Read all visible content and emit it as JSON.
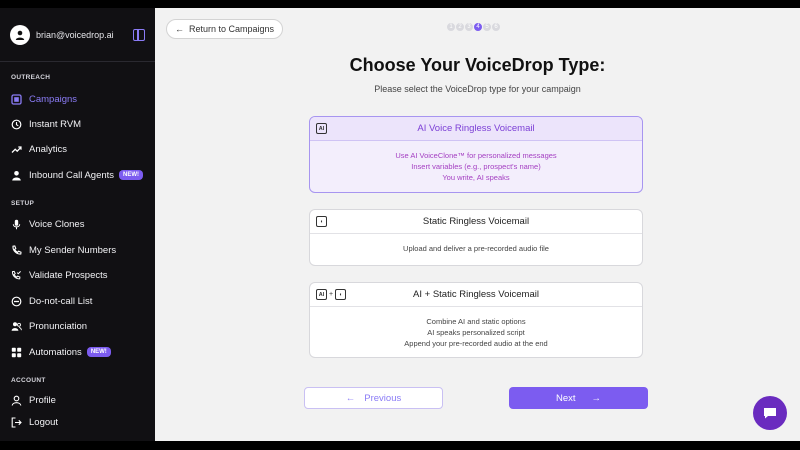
{
  "user": {
    "email": "brian@voicedrop.ai"
  },
  "sidebar": {
    "sections": {
      "outreach": "OUTREACH",
      "setup": "SETUP",
      "account": "ACCOUNT"
    },
    "items": [
      {
        "label": "Campaigns",
        "icon": "campaigns-icon",
        "active": true
      },
      {
        "label": "Instant RVM",
        "icon": "clock-icon"
      },
      {
        "label": "Analytics",
        "icon": "trend-icon"
      },
      {
        "label": "Inbound Call Agents",
        "icon": "person-icon",
        "badge": "NEW!"
      },
      {
        "label": "Voice Clones",
        "icon": "mic-icon"
      },
      {
        "label": "My Sender Numbers",
        "icon": "phone-icon"
      },
      {
        "label": "Validate Prospects",
        "icon": "phone-check-icon"
      },
      {
        "label": "Do-not-call List",
        "icon": "block-icon"
      },
      {
        "label": "Pronunciation",
        "icon": "users-icon"
      },
      {
        "label": "Automations",
        "icon": "grid-icon",
        "badge": "NEW!"
      },
      {
        "label": "Profile",
        "icon": "profile-icon"
      },
      {
        "label": "Logout",
        "icon": "logout-icon"
      }
    ]
  },
  "main": {
    "back_label": "Return to Campaigns",
    "steps": [
      "1",
      "2",
      "3",
      "4",
      "5",
      "6"
    ],
    "current_step": "4",
    "title": "Choose Your VoiceDrop Type:",
    "subtitle": "Please select the VoiceDrop type for your campaign",
    "options": [
      {
        "title": "AI Voice Ringless Voicemail",
        "lines": [
          "Use AI VoiceClone™ for personalized messages",
          "Insert variables (e.g., prospect's name)",
          "You write, AI speaks"
        ],
        "selected": true
      },
      {
        "title": "Static Ringless Voicemail",
        "lines": [
          "Upload and deliver a pre-recorded audio file"
        ],
        "selected": false
      },
      {
        "title": "AI + Static Ringless Voicemail",
        "lines": [
          "Combine AI and static options",
          "AI speaks personalized script",
          "Append your pre-recorded audio at the end"
        ],
        "selected": false
      }
    ],
    "previous_label": "Previous",
    "next_label": "Next"
  },
  "colors": {
    "accent": "#7c5cf0",
    "sidebar_bg": "#111013",
    "main_bg": "#f2f2f2"
  }
}
